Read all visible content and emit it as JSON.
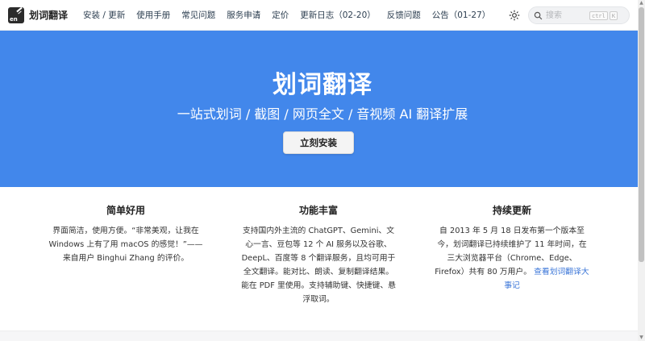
{
  "header": {
    "brand": {
      "name": "划词翻译",
      "logo_text": "en"
    },
    "nav": [
      {
        "label": "安装 / 更新"
      },
      {
        "label": "使用手册"
      },
      {
        "label": "常见问题"
      },
      {
        "label": "服务申请"
      },
      {
        "label": "定价"
      },
      {
        "label": "更新日志（02-20）"
      },
      {
        "label": "反馈问题"
      },
      {
        "label": "公告（01-27）"
      }
    ],
    "search": {
      "placeholder": "搜索",
      "shortcut_ctrl": "ctrl",
      "shortcut_key": "K"
    },
    "icons": {
      "theme": "sun-icon",
      "search": "search-icon"
    }
  },
  "hero": {
    "title": "划词翻译",
    "subtitle": "一站式划词 / 截图 / 网页全文 / 音视频 AI 翻译扩展",
    "button": "立刻安装",
    "background": "#4287eb"
  },
  "features": [
    {
      "title": "简单好用",
      "lines": [
        "界面简洁，使用方便。“非常美观，让我在",
        "Windows 上有了用 macOS 的感觉！”——",
        "来自用户 Binghui Zhang 的评价。"
      ]
    },
    {
      "title": "功能丰富",
      "lines": [
        "支持国内外主流的 ChatGPT、Gemini、文",
        "心一言、豆包等 12 个 AI 服务以及谷歌、",
        "DeepL、百度等 8 个翻译服务，且均可用于",
        "全文翻译。能对比、朗读、复制翻译结果。",
        "能在 PDF 里使用。支持辅助键、快捷键、悬",
        "浮取词。"
      ]
    },
    {
      "title": "持续更新",
      "lines": [
        "自 2013 年 5 月 18 日发布第一个版本至",
        "今，划词翻译已持续维护了 11 年时间，在",
        "三大浏览器平台（Chrome、Edge、"
      ],
      "line4_text": "Firefox）共有 80 万用户。",
      "line4_link": "查看划词翻译大",
      "line5_link": "事记",
      "link_color": "#3b76d8"
    }
  ]
}
